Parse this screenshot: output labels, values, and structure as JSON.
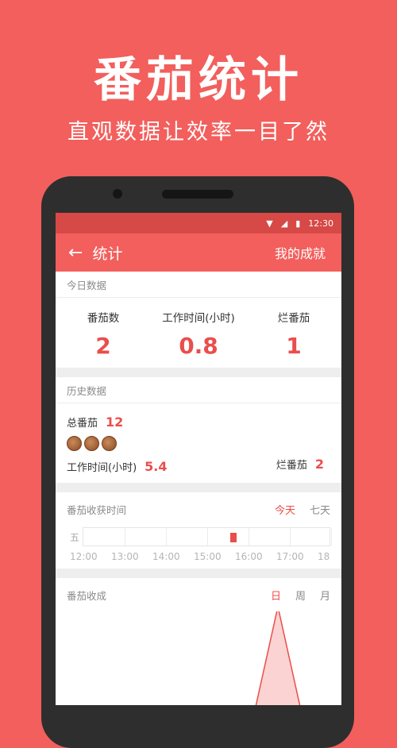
{
  "promo": {
    "title": "番茄统计",
    "subtitle": "直观数据让效率一目了然"
  },
  "status_bar": {
    "time": "12:30"
  },
  "app_bar": {
    "title": "统计",
    "action": "我的成就"
  },
  "today": {
    "label": "今日数据",
    "items": [
      {
        "label": "番茄数",
        "value": "2"
      },
      {
        "label": "工作时间(小时)",
        "value": "0.8"
      },
      {
        "label": "烂番茄",
        "value": "1"
      }
    ]
  },
  "history": {
    "label": "历史数据",
    "total_label": "总番茄",
    "total_value": "12",
    "work_label": "工作时间(小时)",
    "work_value": "5.4",
    "rotten_label": "烂番茄",
    "rotten_value": "2"
  },
  "harvest_time": {
    "label": "番茄收获时间",
    "tabs": [
      "今天",
      "七天"
    ],
    "active_tab": 0,
    "day_label": "五",
    "ticks": [
      "12:00",
      "13:00",
      "14:00",
      "15:00",
      "16:00",
      "17:00",
      "18"
    ],
    "marker_hour": 15.55
  },
  "harvest": {
    "label": "番茄收成",
    "tabs": [
      "日",
      "周",
      "月"
    ],
    "active_tab": 0
  },
  "colors": {
    "accent": "#f25f5c",
    "value_red": "#ea4e4b",
    "status_bar": "#d64946"
  },
  "icons": {
    "back": "arrow-left-icon",
    "wifi": "wifi-icon",
    "signal": "signal-icon",
    "battery": "battery-icon"
  }
}
